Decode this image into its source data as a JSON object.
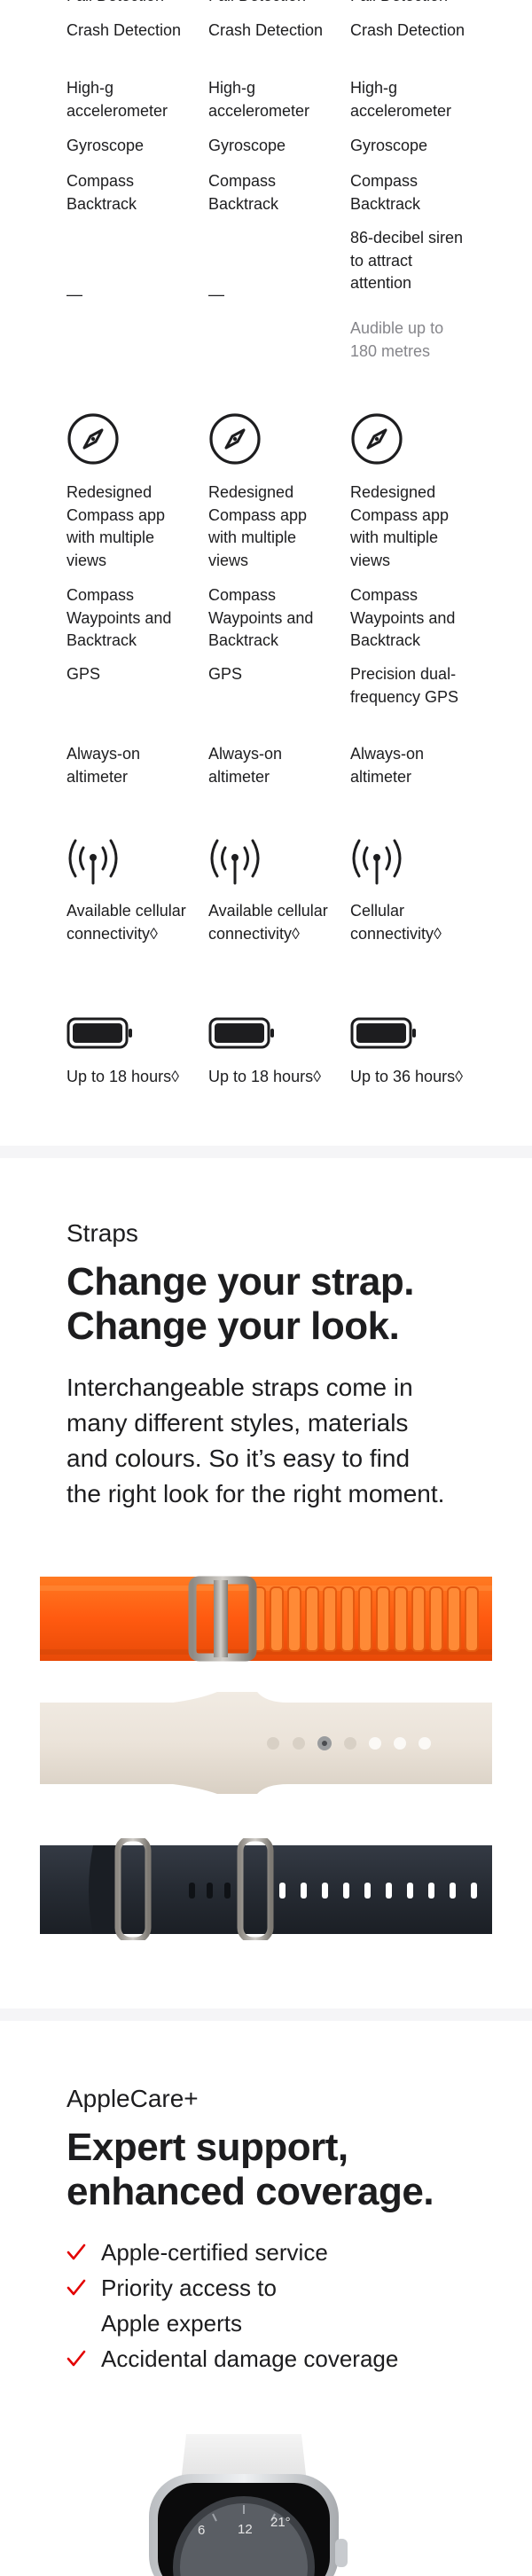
{
  "compare": {
    "columns": [
      {
        "safety": [
          "Fall Detection",
          "Crash Detection",
          "High-g accelerometer",
          "Gyroscope",
          "Compass Backtrack"
        ],
        "siren": "—",
        "siren_sub": "",
        "nav": [
          "Redesigned Compass app with multiple views",
          "Compass Waypoints and Backtrack",
          "GPS",
          "Always-on altimeter"
        ],
        "connectivity": "Available cellular connectivity◊",
        "battery": "Up to 18 hours◊"
      },
      {
        "safety": [
          "Fall Detection",
          "Crash Detection",
          "High-g accelerometer",
          "Gyroscope",
          "Compass Backtrack"
        ],
        "siren": "—",
        "siren_sub": "",
        "nav": [
          "Redesigned Compass app with multiple views",
          "Compass Waypoints and Backtrack",
          "GPS",
          "Always-on altimeter"
        ],
        "connectivity": "Available cellular connectivity◊",
        "battery": "Up to 18 hours◊"
      },
      {
        "safety": [
          "Fall Detection",
          "Crash Detection",
          "High-g accelerometer",
          "Gyroscope",
          "Compass Backtrack"
        ],
        "siren": "86-decibel siren to attract attention",
        "siren_sub": "Audible up to 180 metres",
        "nav": [
          "Redesigned Compass app with multiple views",
          "Compass Waypoints and Backtrack",
          "Precision dual-frequency GPS",
          "Always-on altimeter"
        ],
        "connectivity": "Cellular connectivity◊",
        "battery": "Up to 36 hours◊"
      }
    ],
    "icons": {
      "nav": "compass-icon",
      "connectivity": "cellular-antenna-icon",
      "battery": "battery-icon"
    }
  },
  "straps": {
    "eyebrow": "Straps",
    "headline_line1": "Change your strap.",
    "headline_line2": "Change your look.",
    "copy_lines": [
      "Interchangeable straps come in",
      "many different styles, materials",
      "and colours. So it’s easy to find",
      "the right look for the right moment."
    ],
    "images": [
      "alpine-loop-orange",
      "sport-band-starlight",
      "ocean-band-midnight"
    ]
  },
  "applecare": {
    "eyebrow": "AppleCare+",
    "headline_line1": "Expert support,",
    "headline_line2": "enhanced coverage.",
    "features": [
      "Apple-certified service",
      "Priority access to",
      "Apple experts",
      "Accidental damage coverage"
    ],
    "watch_numbers": [
      "6",
      "12",
      "21°"
    ]
  },
  "colors": {
    "text": "#1d1d1f",
    "secondary": "#86868b",
    "check": "#e30000",
    "divider": "#f5f5f7",
    "orange": "#ff6a1a",
    "starlight": "#ebe3d9",
    "midnight": "#262b33"
  }
}
